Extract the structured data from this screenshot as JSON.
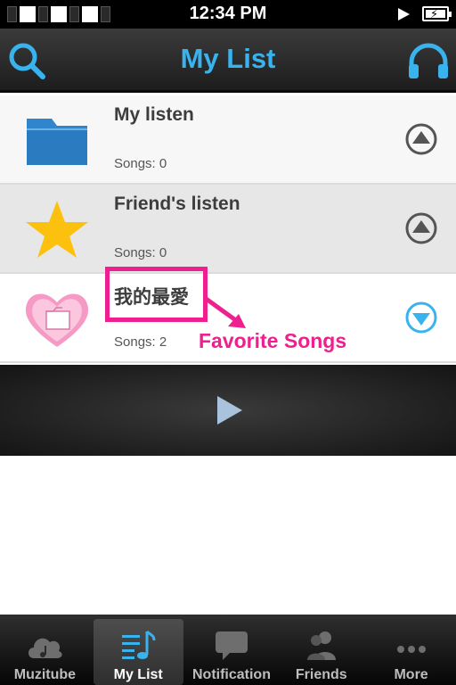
{
  "status_bar": {
    "time": "12:34 PM"
  },
  "nav": {
    "title": "My List",
    "left_icon": "search-icon",
    "right_icon": "headphones-icon"
  },
  "colors": {
    "accent": "#39b3ee",
    "annotation": "#ee1f8f",
    "folder": "#2f86cc",
    "star": "#fcc10f",
    "heart": "#f59ac4"
  },
  "playlists": [
    {
      "title": "My listen",
      "songs": "Songs: 0",
      "icon": "folder-icon",
      "arrow": "expand-up-icon"
    },
    {
      "title": "Friend's listen",
      "songs": "Songs: 0",
      "icon": "star-icon",
      "arrow": "expand-up-icon"
    },
    {
      "title": "我的最愛",
      "songs": "Songs: 2",
      "icon": "heart-folder-icon",
      "arrow": "expand-down-icon"
    }
  ],
  "annotation": {
    "label": "Favorite Songs"
  },
  "player": {
    "icon": "play-icon"
  },
  "tabs": [
    {
      "label": "Muzitube",
      "icon": "cloud-music-icon",
      "active": false
    },
    {
      "label": "My List",
      "icon": "music-list-icon",
      "active": true
    },
    {
      "label": "Notification",
      "icon": "chat-bubble-icon",
      "active": false
    },
    {
      "label": "Friends",
      "icon": "friends-icon",
      "active": false
    },
    {
      "label": "More",
      "icon": "more-dots-icon",
      "active": false
    }
  ]
}
